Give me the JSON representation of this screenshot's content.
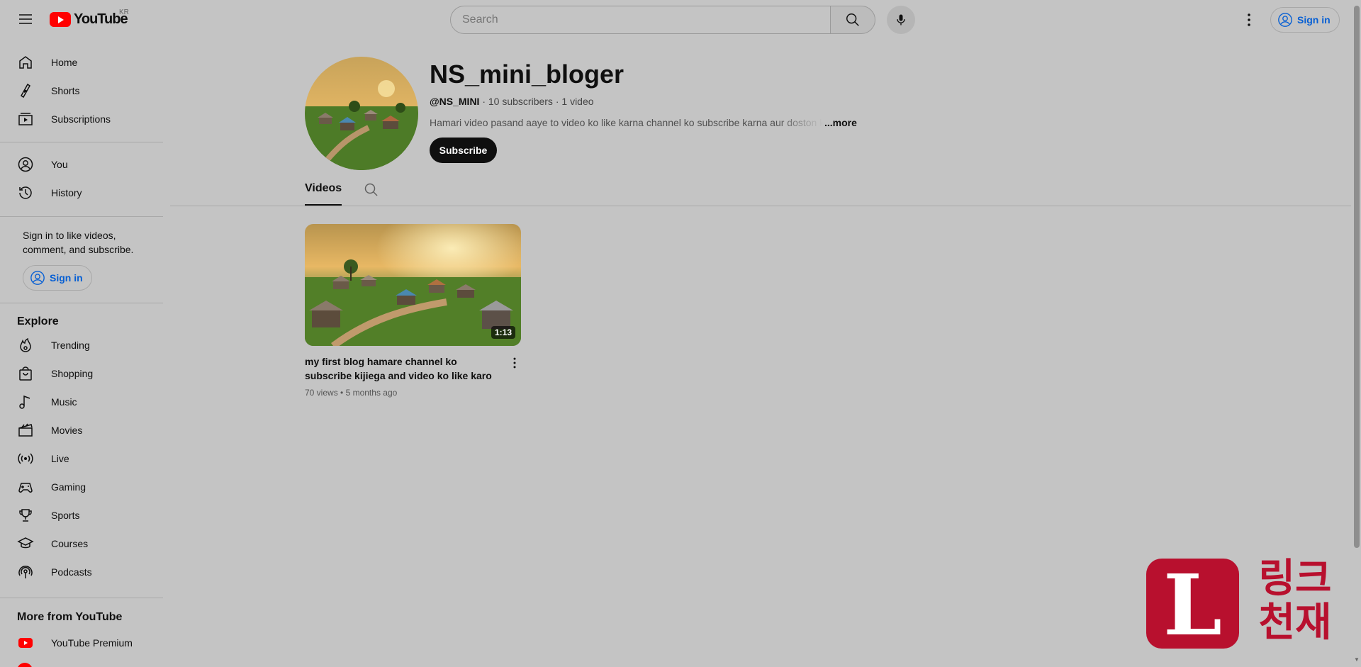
{
  "header": {
    "logo_text": "YouTube",
    "country_code": "KR",
    "search_placeholder": "Search",
    "signin_label": "Sign in"
  },
  "sidebar": {
    "primary": [
      {
        "label": "Home",
        "icon": "home-icon"
      },
      {
        "label": "Shorts",
        "icon": "shorts-icon"
      },
      {
        "label": "Subscriptions",
        "icon": "subscriptions-icon"
      }
    ],
    "you": [
      {
        "label": "You",
        "icon": "account-icon"
      },
      {
        "label": "History",
        "icon": "history-icon"
      }
    ],
    "signin_prompt": "Sign in to like videos, comment, and subscribe.",
    "signin_label": "Sign in",
    "explore_title": "Explore",
    "explore": [
      {
        "label": "Trending",
        "icon": "trending-icon"
      },
      {
        "label": "Shopping",
        "icon": "shopping-bag-icon"
      },
      {
        "label": "Music",
        "icon": "music-note-icon"
      },
      {
        "label": "Movies",
        "icon": "clapperboard-icon"
      },
      {
        "label": "Live",
        "icon": "live-icon"
      },
      {
        "label": "Gaming",
        "icon": "gamepad-icon"
      },
      {
        "label": "Sports",
        "icon": "trophy-icon"
      },
      {
        "label": "Courses",
        "icon": "graduation-cap-icon"
      },
      {
        "label": "Podcasts",
        "icon": "podcast-icon"
      }
    ],
    "more_title": "More from YouTube",
    "more": [
      {
        "label": "YouTube Premium",
        "icon": "youtube-premium-icon"
      }
    ]
  },
  "channel": {
    "name": "NS_mini_bloger",
    "handle": "@NS_MINI",
    "subscribers": "10 subscribers",
    "video_count": "1 video",
    "description": "Hamari video pasand aaye to video ko like karna channel ko subscribe karna aur doston ko",
    "more_label": "...more",
    "subscribe_label": "Subscribe"
  },
  "tabs": {
    "videos_label": "Videos"
  },
  "videos": [
    {
      "title": "my first blog hamare channel ko subscribe kijiega and video ko like karo aur support karo",
      "duration": "1:13",
      "views": "70 views",
      "age": "5 months ago"
    }
  ],
  "watermark": {
    "letter": "L",
    "text_line1": "링크",
    "text_line2": "천재"
  },
  "colors": {
    "brand_red": "#ff0000",
    "link_blue": "#065fd4",
    "watermark_red": "#b8102e"
  }
}
